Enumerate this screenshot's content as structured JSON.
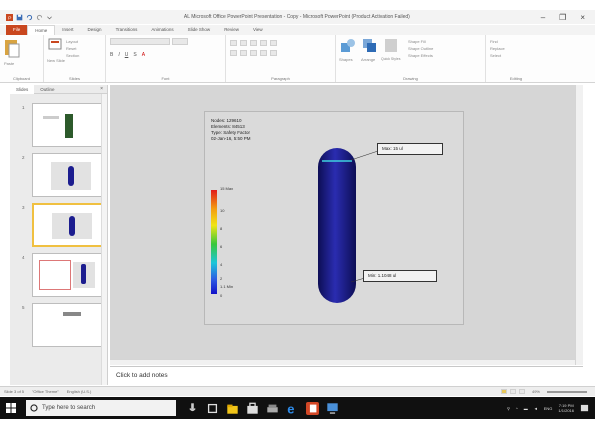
{
  "window": {
    "title": "AL Microsoft Office PowerPoint Presentation - Copy  -  Microsoft PowerPoint (Product Activation Failed)",
    "minimize_glyph": "–",
    "restore_glyph": "❐",
    "close_glyph": "×"
  },
  "ribbon_tabs": [
    "File",
    "Home",
    "Insert",
    "Design",
    "Transitions",
    "Animations",
    "Slide Show",
    "Review",
    "View"
  ],
  "ribbon": {
    "clipboard": {
      "paste_label": "Paste",
      "group_label": "Clipboard"
    },
    "slides": {
      "new_slide_label": "New Slide",
      "layout_label": "Layout",
      "reset_label": "Reset",
      "section_label": "Section",
      "group_label": "Slides"
    },
    "font": {
      "group_label": "Font"
    },
    "paragraph": {
      "group_label": "Paragraph"
    },
    "drawing": {
      "shapes_label": "Shapes",
      "arrange_label": "Arrange",
      "quick_styles_label": "Quick Styles",
      "shape_fill_label": "Shape Fill",
      "shape_outline_label": "Shape Outline",
      "shape_effects_label": "Shape Effects",
      "group_label": "Drawing"
    },
    "editing": {
      "find_label": "Find",
      "replace_label": "Replace",
      "select_label": "Select",
      "group_label": "Editing"
    }
  },
  "slide_pane": {
    "tabs": [
      "Slides",
      "Outline"
    ],
    "close_glyph": "×",
    "slides": [
      {
        "number": "1"
      },
      {
        "number": "2"
      },
      {
        "number": "3",
        "selected": true
      },
      {
        "number": "4"
      },
      {
        "number": "5"
      }
    ]
  },
  "slide": {
    "info_lines": [
      "Nodes: 129610",
      "Elements: 84513",
      "Type: Safety Factor",
      "02-Jan-16, 5:50 PM"
    ],
    "legend_max": "15 Max",
    "legend_ticks": [
      "10",
      "8",
      "6",
      "4",
      "2",
      "1.1 Min",
      "0"
    ],
    "max_callout": "Max: 15  ul",
    "min_callout": "Min: 1.1048  ul"
  },
  "notes_placeholder": "Click to add notes",
  "status_bar": {
    "slide_indicator": "Slide 3 of 5",
    "theme": "\"Office Theme\"",
    "language": "English (U.S.)",
    "zoom": "49%"
  },
  "taskbar": {
    "search_placeholder": "Type here to search",
    "time": "7:19 PM",
    "date": "1/1/2016",
    "language": "ENG"
  },
  "colors": {
    "file_tab": "#c9471f",
    "taskbar": "#101010",
    "tank_body": "#1c1d8f"
  }
}
